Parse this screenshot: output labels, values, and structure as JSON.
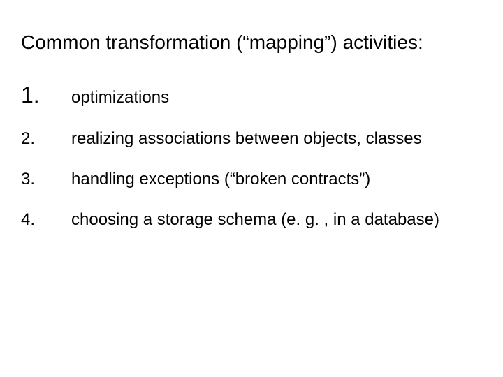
{
  "title": "Common transformation (“mapping”) activities:",
  "items": [
    {
      "num": "1.",
      "text": "optimizations",
      "big": true
    },
    {
      "num": "2.",
      "text": "realizing associations between objects, classes",
      "big": false
    },
    {
      "num": "3.",
      "text": "handling exceptions (“broken contracts”)",
      "big": false
    },
    {
      "num": "4.",
      "text": "choosing a storage schema (e. g. , in a database)",
      "big": false
    }
  ]
}
